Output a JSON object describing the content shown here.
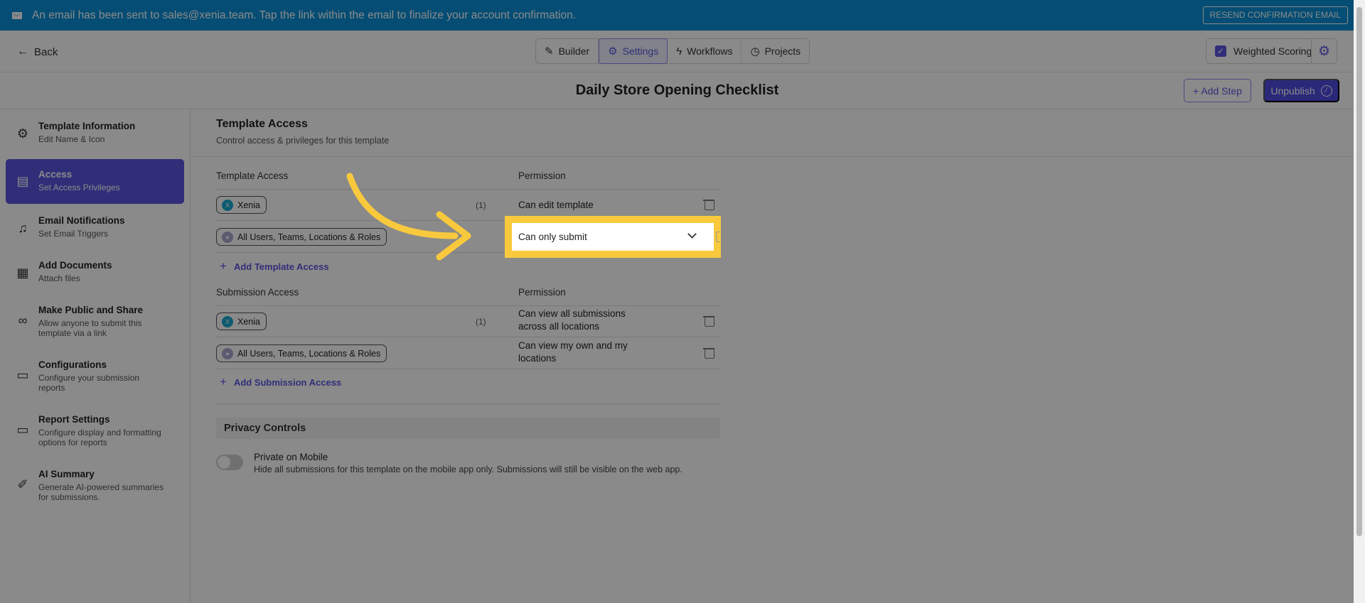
{
  "banner": {
    "message": "An email has been sent to sales@xenia.team. Tap the link within the email to finalize your account confirmation.",
    "resend_label": "RESEND CONFIRMATION EMAIL"
  },
  "topbar": {
    "back_label": "Back",
    "tabs": [
      {
        "label": "Builder",
        "icon": "pencil-icon"
      },
      {
        "label": "Settings",
        "icon": "gear-icon",
        "active": true
      },
      {
        "label": "Workflows",
        "icon": "bolt-icon"
      },
      {
        "label": "Projects",
        "icon": "clock-icon"
      }
    ],
    "weighted_scoring_label": "Weighted Scoring",
    "weighted_scoring_checked": true
  },
  "titlebar": {
    "title": "Daily Store Opening Checklist",
    "add_step_label": "+ Add Step",
    "unpublish_label": "Unpublish"
  },
  "sidebar": {
    "items": [
      {
        "title": "Template Information",
        "subtitle": "Edit Name & Icon",
        "icon": "gear-icon"
      },
      {
        "title": "Access",
        "subtitle": "Set Access Privileges",
        "icon": "document-lock-icon",
        "active": true
      },
      {
        "title": "Email Notifications",
        "subtitle": "Set Email Triggers",
        "icon": "bell-icon"
      },
      {
        "title": "Add Documents",
        "subtitle": "Attach files",
        "icon": "documents-icon"
      },
      {
        "title": "Make Public and Share",
        "subtitle": "Allow anyone to submit this template via a link",
        "icon": "link-icon"
      },
      {
        "title": "Configurations",
        "subtitle": "Configure your submission reports",
        "icon": "presentation-icon"
      },
      {
        "title": "Report Settings",
        "subtitle": "Configure display and formatting options for reports",
        "icon": "report-icon"
      },
      {
        "title": "AI Summary",
        "subtitle": "Generate AI-powered summaries for submissions.",
        "icon": "sparkle-pen-icon"
      }
    ]
  },
  "main": {
    "heading": "Template Access",
    "subheading": "Control access & privileges for this template",
    "template_access": {
      "col_access": "Template Access",
      "col_permission": "Permission",
      "rows": [
        {
          "chip": "Xenia",
          "avatar": "X",
          "count": "(1)",
          "permission": "Can edit template"
        },
        {
          "chip": "All Users, Teams, Locations & Roles",
          "count": "",
          "permission": "Can only submit"
        }
      ],
      "add_label": "Add Template Access"
    },
    "submission_access": {
      "col_access": "Submission Access",
      "col_permission": "Permission",
      "rows": [
        {
          "chip": "Xenia",
          "avatar": "X",
          "count": "(1)",
          "permission_l1": "Can view all submissions",
          "permission_l2": "across all locations"
        },
        {
          "chip": "All Users, Teams, Locations & Roles",
          "count": "",
          "permission_l1": "Can view my own and my",
          "permission_l2": "locations"
        }
      ],
      "add_label": "Add Submission Access"
    },
    "privacy": {
      "heading": "Privacy Controls",
      "toggle_title": "Private on Mobile",
      "toggle_sub": "Hide all submissions for this template on the mobile app only. Submissions will still be visible on the web app.",
      "toggle_on": false
    }
  },
  "highlight": {
    "select_value": "Can only submit"
  },
  "colors": {
    "banner": "#0a8fd6",
    "accent": "#5a56e0",
    "highlight": "#f9c93d"
  }
}
